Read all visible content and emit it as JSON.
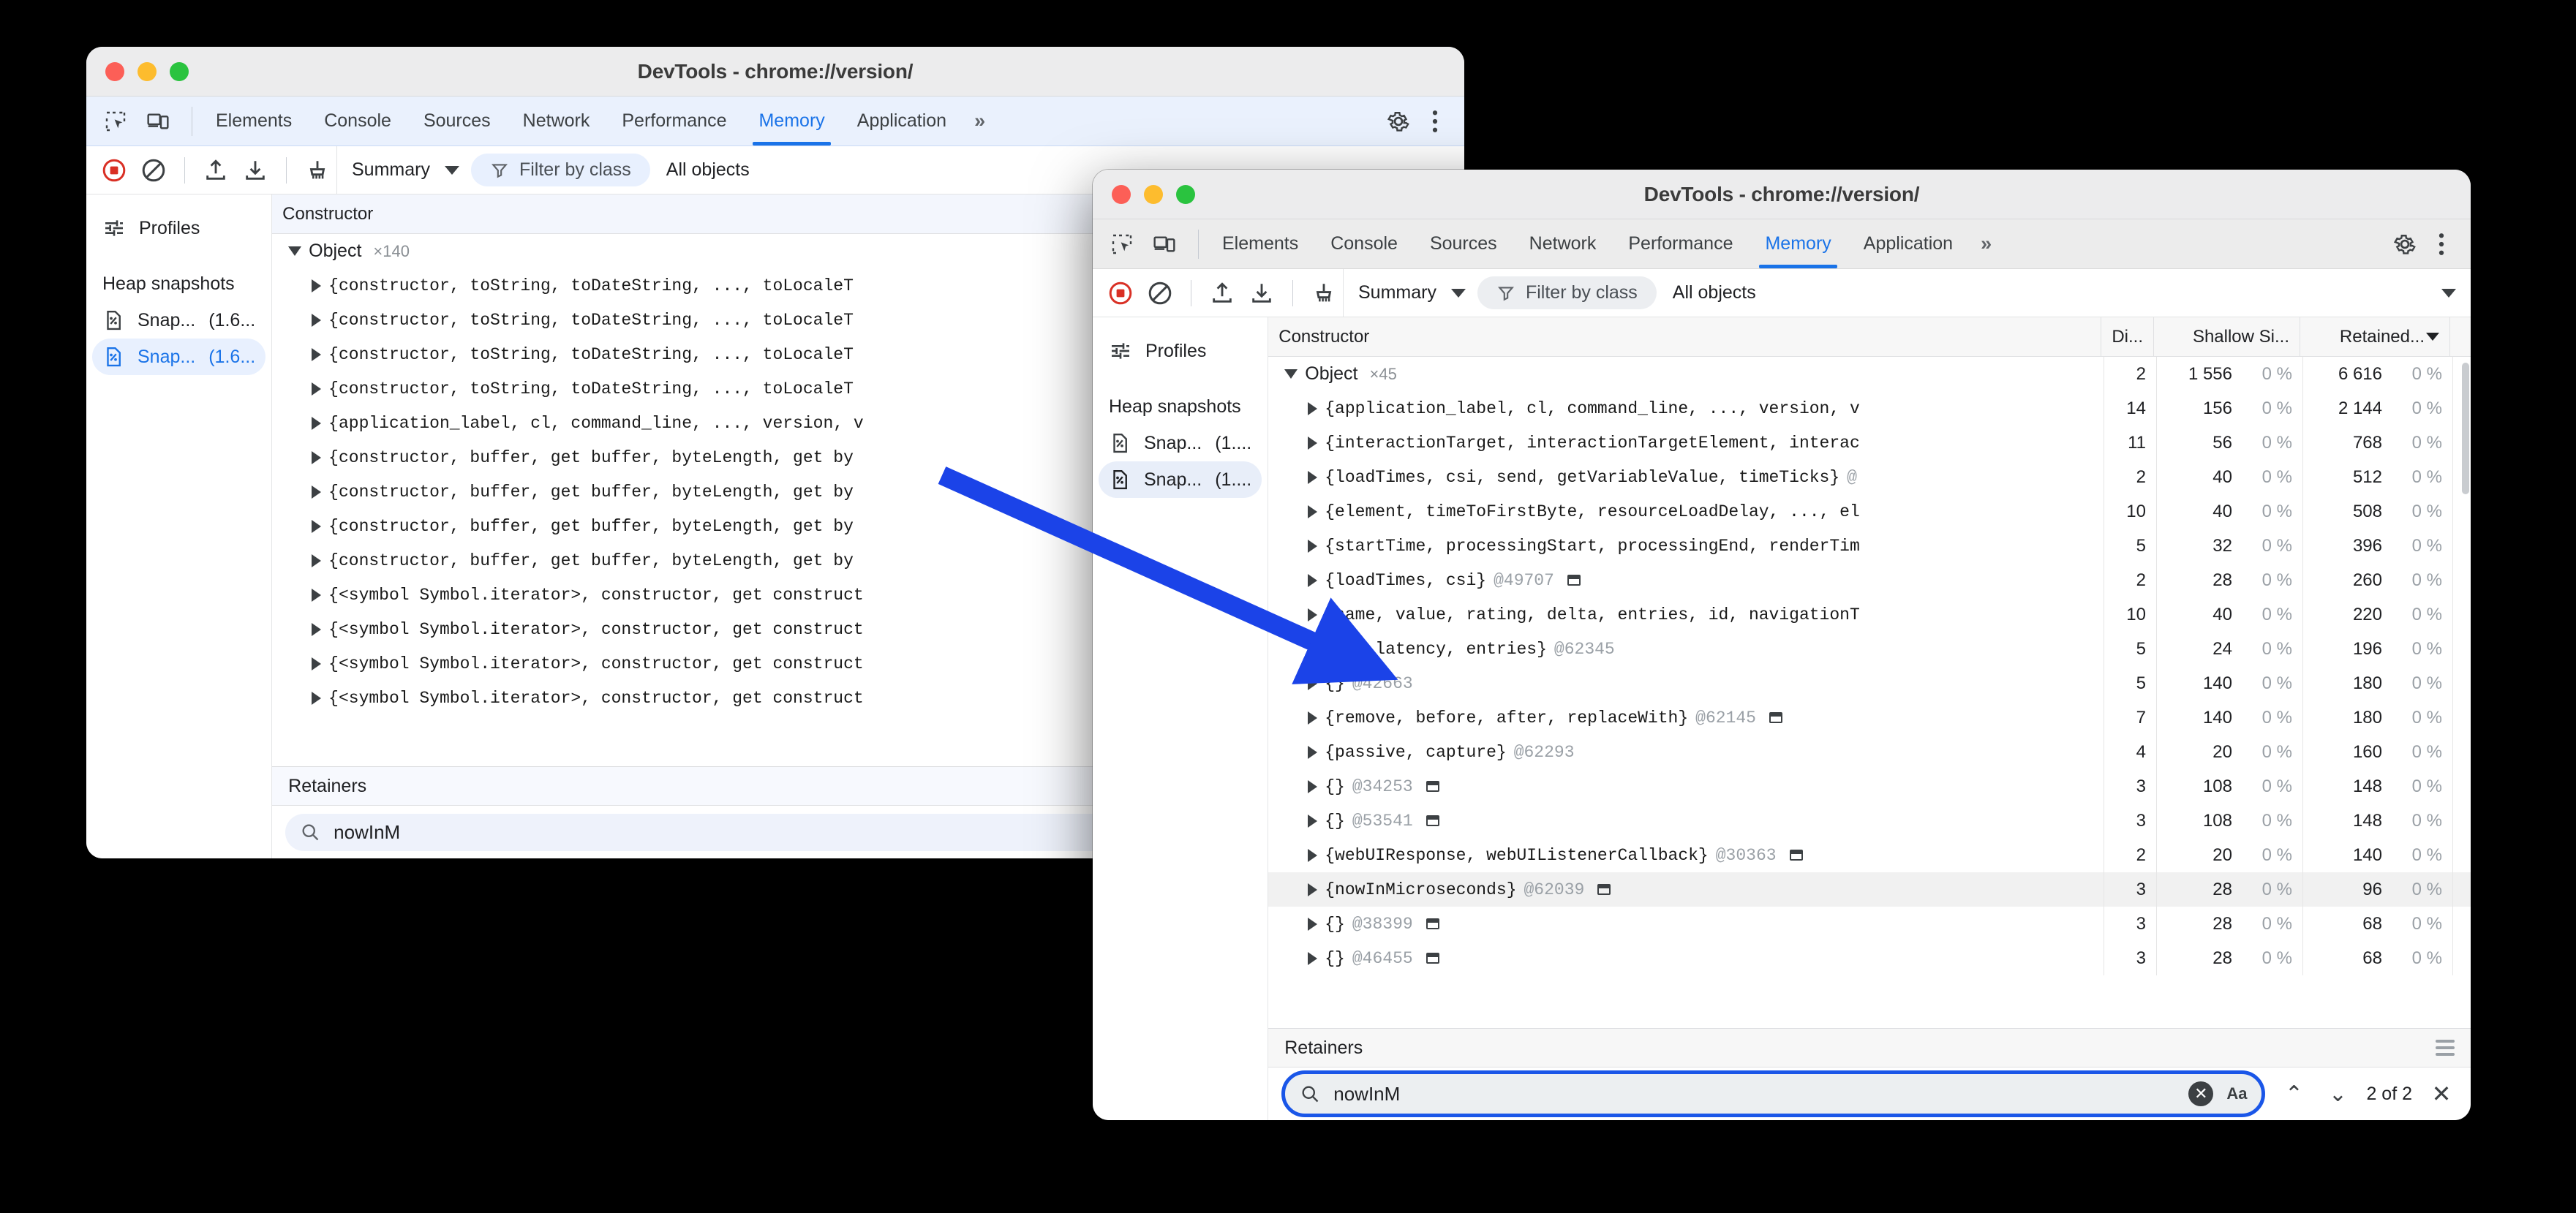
{
  "accent": {
    "blue": "#1a73e8",
    "arrow": "#1b43e8",
    "muted": "#9aa0a6"
  },
  "window_back": {
    "title": "DevTools - chrome://version/",
    "tabs": [
      {
        "label": "Elements",
        "active": false
      },
      {
        "label": "Console",
        "active": false
      },
      {
        "label": "Sources",
        "active": false
      },
      {
        "label": "Network",
        "active": false
      },
      {
        "label": "Performance",
        "active": false
      },
      {
        "label": "Memory",
        "active": true
      },
      {
        "label": "Application",
        "active": false
      },
      {
        "label": "»",
        "active": false
      }
    ],
    "toolbar": {
      "view_select": "Summary",
      "filter_placeholder": "Filter by class",
      "objects_scope": "All objects"
    },
    "sidebar": {
      "profiles": "Profiles",
      "section_title": "Heap snapshots",
      "snapshots": [
        {
          "label": "Snap...",
          "size": "(1.6...",
          "selected": false
        },
        {
          "label": "Snap...",
          "size": "(1.6...",
          "selected": true
        }
      ]
    },
    "grid": {
      "columns": [
        "Constructor"
      ],
      "group": {
        "name": "Object",
        "count": "×140"
      },
      "rows": [
        "{constructor, toString, toDateString, ..., toLocaleT",
        "{constructor, toString, toDateString, ..., toLocaleT",
        "{constructor, toString, toDateString, ..., toLocaleT",
        "{constructor, toString, toDateString, ..., toLocaleT",
        "{application_label, cl, command_line, ..., version, v",
        "{constructor, buffer, get buffer, byteLength, get by",
        "{constructor, buffer, get buffer, byteLength, get by",
        "{constructor, buffer, get buffer, byteLength, get by",
        "{constructor, buffer, get buffer, byteLength, get by",
        "{<symbol Symbol.iterator>, constructor, get construct",
        "{<symbol Symbol.iterator>, constructor, get construct",
        "{<symbol Symbol.iterator>, constructor, get construct",
        "{<symbol Symbol.iterator>, constructor, get construct"
      ]
    },
    "retainers": {
      "title": "Retainers",
      "search_value": "nowInM"
    }
  },
  "window_front": {
    "title": "DevTools - chrome://version/",
    "tabs": [
      {
        "label": "Elements",
        "active": false
      },
      {
        "label": "Console",
        "active": false
      },
      {
        "label": "Sources",
        "active": false
      },
      {
        "label": "Network",
        "active": false
      },
      {
        "label": "Performance",
        "active": false
      },
      {
        "label": "Memory",
        "active": true
      },
      {
        "label": "Application",
        "active": false
      },
      {
        "label": "»",
        "active": false
      }
    ],
    "toolbar": {
      "view_select": "Summary",
      "filter_placeholder": "Filter by class",
      "objects_scope": "All objects"
    },
    "sidebar": {
      "profiles": "Profiles",
      "section_title": "Heap snapshots",
      "snapshots": [
        {
          "label": "Snap...",
          "size": "(1....",
          "selected": false
        },
        {
          "label": "Snap...",
          "size": "(1....",
          "selected": true
        }
      ]
    },
    "grid": {
      "columns": [
        "Constructor",
        "Di...",
        "Shallow Si...",
        "Retained..."
      ],
      "sorted_column": "Retained...",
      "group": {
        "name": "Object",
        "count": "×45",
        "distance": "2",
        "shallow": "1 556",
        "shallow_pct": "0 %",
        "retained": "6 616",
        "retained_pct": "0 %"
      },
      "rows": [
        {
          "text": "{application_label, cl, command_line, ..., version, v",
          "at": "",
          "window": false,
          "distance": "14",
          "shallow": "156",
          "shallow_pct": "0 %",
          "retained": "2 144",
          "retained_pct": "0 %",
          "selected": false
        },
        {
          "text": "{interactionTarget, interactionTargetElement, interac",
          "at": "",
          "window": false,
          "distance": "11",
          "shallow": "56",
          "shallow_pct": "0 %",
          "retained": "768",
          "retained_pct": "0 %",
          "selected": false
        },
        {
          "text": "{loadTimes, csi, send, getVariableValue, timeTicks}",
          "at": "@",
          "window": false,
          "distance": "2",
          "shallow": "40",
          "shallow_pct": "0 %",
          "retained": "512",
          "retained_pct": "0 %",
          "selected": false
        },
        {
          "text": "{element, timeToFirstByte, resourceLoadDelay, ..., el",
          "at": "",
          "window": false,
          "distance": "10",
          "shallow": "40",
          "shallow_pct": "0 %",
          "retained": "508",
          "retained_pct": "0 %",
          "selected": false
        },
        {
          "text": "{startTime, processingStart, processingEnd, renderTim",
          "at": "",
          "window": false,
          "distance": "5",
          "shallow": "32",
          "shallow_pct": "0 %",
          "retained": "396",
          "retained_pct": "0 %",
          "selected": false
        },
        {
          "text": "{loadTimes, csi}",
          "at": "@49707",
          "window": true,
          "distance": "2",
          "shallow": "28",
          "shallow_pct": "0 %",
          "retained": "260",
          "retained_pct": "0 %",
          "selected": false
        },
        {
          "text": "{name, value, rating, delta, entries, id, navigationT",
          "at": "",
          "window": false,
          "distance": "10",
          "shallow": "40",
          "shallow_pct": "0 %",
          "retained": "220",
          "retained_pct": "0 %",
          "selected": false
        },
        {
          "text": "{id, latency, entries}",
          "at": "@62345",
          "window": false,
          "distance": "5",
          "shallow": "24",
          "shallow_pct": "0 %",
          "retained": "196",
          "retained_pct": "0 %",
          "selected": false
        },
        {
          "text": "{}",
          "at": "@42663",
          "window": false,
          "distance": "5",
          "shallow": "140",
          "shallow_pct": "0 %",
          "retained": "180",
          "retained_pct": "0 %",
          "selected": false
        },
        {
          "text": "{remove, before, after, replaceWith}",
          "at": "@62145",
          "window": true,
          "distance": "7",
          "shallow": "140",
          "shallow_pct": "0 %",
          "retained": "180",
          "retained_pct": "0 %",
          "selected": false
        },
        {
          "text": "{passive, capture}",
          "at": "@62293",
          "window": false,
          "distance": "4",
          "shallow": "20",
          "shallow_pct": "0 %",
          "retained": "160",
          "retained_pct": "0 %",
          "selected": false
        },
        {
          "text": "{}",
          "at": "@34253",
          "window": true,
          "distance": "3",
          "shallow": "108",
          "shallow_pct": "0 %",
          "retained": "148",
          "retained_pct": "0 %",
          "selected": false
        },
        {
          "text": "{}",
          "at": "@53541",
          "window": true,
          "distance": "3",
          "shallow": "108",
          "shallow_pct": "0 %",
          "retained": "148",
          "retained_pct": "0 %",
          "selected": false
        },
        {
          "text": "{webUIResponse, webUIListenerCallback}",
          "at": "@30363",
          "window": true,
          "distance": "2",
          "shallow": "20",
          "shallow_pct": "0 %",
          "retained": "140",
          "retained_pct": "0 %",
          "selected": false
        },
        {
          "text": "{nowInMicroseconds}",
          "at": "@62039",
          "window": true,
          "distance": "3",
          "shallow": "28",
          "shallow_pct": "0 %",
          "retained": "96",
          "retained_pct": "0 %",
          "selected": true
        },
        {
          "text": "{}",
          "at": "@38399",
          "window": true,
          "distance": "3",
          "shallow": "28",
          "shallow_pct": "0 %",
          "retained": "68",
          "retained_pct": "0 %",
          "selected": false
        },
        {
          "text": "{}",
          "at": "@46455",
          "window": true,
          "distance": "3",
          "shallow": "28",
          "shallow_pct": "0 %",
          "retained": "68",
          "retained_pct": "0 %",
          "selected": false
        }
      ]
    },
    "retainers": {
      "title": "Retainers",
      "search_value": "nowInM",
      "match_count": "2 of 2",
      "match_case_label": "Aa",
      "prev_label": "⌃",
      "next_label": "⌄",
      "close_label": "✕"
    }
  }
}
